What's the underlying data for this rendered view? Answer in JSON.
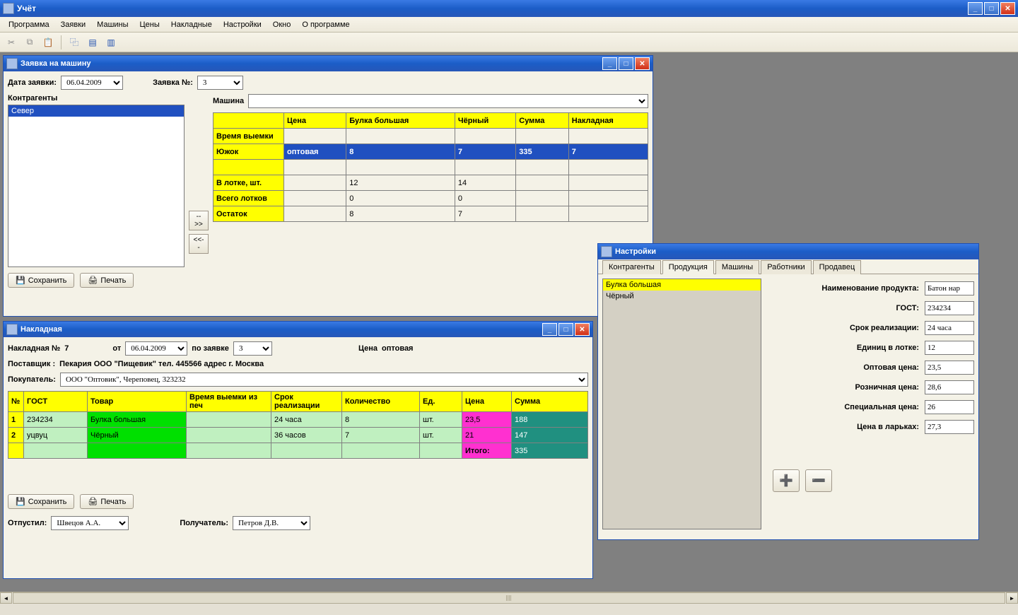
{
  "app": {
    "title": "Учёт"
  },
  "menu": {
    "program": "Программа",
    "requests": "Заявки",
    "machines": "Машины",
    "prices": "Цены",
    "invoices": "Накладные",
    "settings": "Настройки",
    "window": "Окно",
    "about": "О программе"
  },
  "win1": {
    "title": "Заявка на машину",
    "date_label": "Дата заявки:",
    "date_value": "06.04.2009",
    "reqno_label": "Заявка №:",
    "reqno_value": "3",
    "contragents_label": "Контрагенты",
    "machine_label": "Машина",
    "machine_value": "",
    "list": {
      "item0": "Север"
    },
    "tbl": {
      "h_price": "Цена",
      "h_bulka": "Булка большая",
      "h_black": "Чёрный",
      "h_sum": "Сумма",
      "h_invoice": "Накладная",
      "r_time": "Время выемки",
      "r_yuzhok": "Южок",
      "r_yuzhok_price": "оптовая",
      "r_yuzhok_bulka": "8",
      "r_yuzhok_black": "7",
      "r_yuzhok_sum": "335",
      "r_yuzhok_inv": "7",
      "r_tray": "В лотке, шт.",
      "r_tray_bulka": "12",
      "r_tray_black": "14",
      "r_total": "Всего лотков",
      "r_total_bulka": "0",
      "r_total_black": "0",
      "r_rest": "Остаток",
      "r_rest_bulka": "8",
      "r_rest_black": "7"
    },
    "btn_right": "-->>",
    "btn_left": "<<--",
    "btn_save": "Сохранить",
    "btn_print": "Печать"
  },
  "win2": {
    "title": "Накладная",
    "invno_label": "Накладная №",
    "invno_value": "7",
    "from_label": "от",
    "from_value": "06.04.2009",
    "byreq_label": "по заявке",
    "byreq_value": "3",
    "price_label": "Цена",
    "price_value": "оптовая",
    "supplier_label": "Поставщик :",
    "supplier_value": "Пекария ООО \"Пищевик\" тел. 445566 адрес г. Москва",
    "buyer_label": "Покупатель:",
    "buyer_value": "ООО \"Оптовик\", Череповец, 323232",
    "tbl": {
      "h_no": "№",
      "h_gost": "ГОСТ",
      "h_goods": "Товар",
      "h_time": "Время выемки из печ",
      "h_srok": "Срок реализации",
      "h_qty": "Количество",
      "h_unit": "Ед.",
      "h_price": "Цена",
      "h_sum": "Сумма",
      "r1_no": "1",
      "r1_gost": "234234",
      "r1_goods": "Булка большая",
      "r1_time": "",
      "r1_srok": "24 часа",
      "r1_qty": "8",
      "r1_unit": "шт.",
      "r1_price": "23,5",
      "r1_sum": "188",
      "r2_no": "2",
      "r2_gost": "уцвуц",
      "r2_goods": "Чёрный",
      "r2_time": "",
      "r2_srok": "36 часов",
      "r2_qty": "7",
      "r2_unit": "шт.",
      "r2_price": "21",
      "r2_sum": "147",
      "total_label": "Итого:",
      "total_sum": "335"
    },
    "btn_save": "Сохранить",
    "btn_print": "Печать",
    "released_label": "Отпустил:",
    "released_value": "Швецов А.А.",
    "receiver_label": "Получатель:",
    "receiver_value": "Петров Д.В."
  },
  "win3": {
    "title": "Настройки",
    "tabs": {
      "contragents": "Контрагенты",
      "products": "Продукция",
      "machines": "Машины",
      "workers": "Работники",
      "seller": "Продавец"
    },
    "list": {
      "item0": "Булка большая",
      "item1": "Чёрный"
    },
    "fields": {
      "name_label": "Наименование продукта:",
      "name_value": "Батон нар",
      "gost_label": "ГОСТ:",
      "gost_value": "234234",
      "srok_label": "Срок реализации:",
      "srok_value": "24 часа",
      "tray_label": "Единиц в лотке:",
      "tray_value": "12",
      "opt_label": "Оптовая цена:",
      "opt_value": "23,5",
      "retail_label": "Розничная цена:",
      "retail_value": "28,6",
      "spec_label": "Специальная цена:",
      "spec_value": "26",
      "kiosk_label": "Цена в ларьках:",
      "kiosk_value": "27,3"
    }
  }
}
